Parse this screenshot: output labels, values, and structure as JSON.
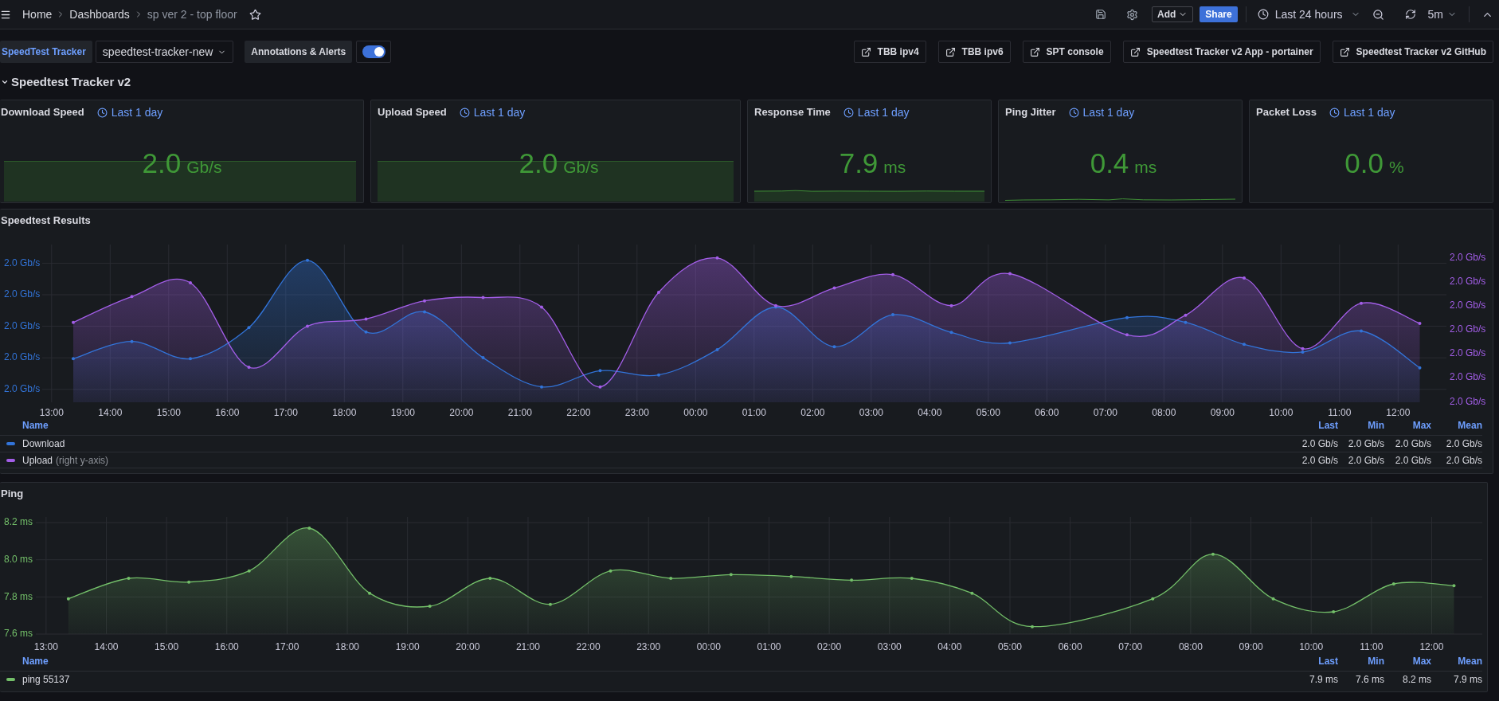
{
  "top_bar": {
    "breadcrumbs": [
      {
        "label": "Home",
        "current": false
      },
      {
        "label": "Dashboards",
        "current": false
      },
      {
        "label": "sp ver 2 - top floor",
        "current": true
      }
    ],
    "add_button": "Add",
    "share_button": "Share",
    "time_range": "Last 24 hours",
    "refresh_interval": "5m"
  },
  "variables": [
    {
      "label": "SpeedTest Tracker",
      "value": "speedtest-tracker-new"
    }
  ],
  "annotations_toggle": {
    "label": "Annotations & Alerts",
    "on": true
  },
  "links": [
    "TBB ipv4",
    "TBB ipv6",
    "SPT console",
    "Speedtest Tracker v2 App - portainer",
    "Speedtest Tracker v2 GitHub"
  ],
  "row": {
    "title": "Speedtest Tracker v2",
    "expanded": true
  },
  "stat_panels": [
    {
      "kind": "block",
      "title": "Download Speed",
      "time_range": "Last 1 day",
      "value": "2.0",
      "unit": "Gb/s"
    },
    {
      "kind": "block",
      "title": "Upload Speed",
      "time_range": "Last 1 day",
      "value": "2.0",
      "unit": "Gb/s"
    },
    {
      "kind": "band",
      "title": "Response Time",
      "time_range": "Last 1 day",
      "value": "7.9",
      "unit": "ms"
    },
    {
      "kind": "line",
      "title": "Ping Jitter",
      "time_range": "Last 1 day",
      "value": "0.4",
      "unit": "ms"
    },
    {
      "kind": "plain",
      "title": "Packet Loss",
      "time_range": "Last 1 day",
      "value": "0.0",
      "unit": "%"
    }
  ],
  "speedtest_results": {
    "title": "Speedtest Results",
    "y_axis_left": [
      "2.0 Gb/s",
      "2.0 Gb/s",
      "2.0 Gb/s",
      "2.0 Gb/s",
      "2.0 Gb/s"
    ],
    "y_axis_right": [
      "2.0 Gb/s",
      "2.0 Gb/s",
      "2.0 Gb/s",
      "2.0 Gb/s",
      "2.0 Gb/s",
      "2.0 Gb/s",
      "2.0 Gb/s"
    ],
    "x_axis": [
      "13:00",
      "14:00",
      "15:00",
      "16:00",
      "17:00",
      "18:00",
      "19:00",
      "20:00",
      "21:00",
      "22:00",
      "23:00",
      "00:00",
      "01:00",
      "02:00",
      "03:00",
      "04:00",
      "05:00",
      "06:00",
      "07:00",
      "08:00",
      "09:00",
      "10:00",
      "11:00",
      "12:00"
    ],
    "legend_columns": [
      "Name",
      "Last",
      "Min",
      "Max",
      "Mean"
    ],
    "series": [
      {
        "name": "Download",
        "color": "#3274d9",
        "stats": [
          "2.0 Gb/s",
          "2.0 Gb/s",
          "2.0 Gb/s",
          "2.0 Gb/s"
        ]
      },
      {
        "name": "Upload",
        "note": "(right y-axis)",
        "color": "#a35ee8",
        "stats": [
          "2.0 Gb/s",
          "2.0 Gb/s",
          "2.0 Gb/s",
          "2.0 Gb/s"
        ]
      }
    ]
  },
  "ping": {
    "title": "Ping",
    "chart_data": {
      "type": "area",
      "grid": true,
      "categories": [
        "13:00",
        "14:00",
        "15:00",
        "16:00",
        "17:00",
        "18:00",
        "19:00",
        "20:00",
        "21:00",
        "22:00",
        "23:00",
        "00:00",
        "01:00",
        "02:00",
        "03:00",
        "04:00",
        "05:00",
        "06:00",
        "07:00",
        "08:00",
        "09:00",
        "10:00",
        "11:00",
        "12:00"
      ],
      "series": [
        {
          "name": "ping 55137",
          "color": "#73bf69",
          "values": [
            7.79,
            7.9,
            7.88,
            7.94,
            8.17,
            7.82,
            7.75,
            7.9,
            7.76,
            7.94,
            7.9,
            7.92,
            7.91,
            7.89,
            7.9,
            7.82,
            7.64,
            null,
            7.79,
            8.03,
            7.79,
            7.72,
            7.87,
            7.86
          ]
        }
      ],
      "ylim": [
        7.6,
        8.23
      ],
      "yticks": [
        {
          "value": 7.6,
          "label": "7.6 ms"
        },
        {
          "value": 7.8,
          "label": "7.8 ms"
        },
        {
          "value": 8,
          "label": "8.0 ms"
        },
        {
          "value": 8.2,
          "label": "8.2 ms"
        }
      ]
    },
    "legend_columns": [
      "Name",
      "Last",
      "Min",
      "Max",
      "Mean"
    ],
    "legend_stats": [
      [
        "7.9 ms",
        "7.6 ms",
        "8.2 ms",
        "7.9 ms"
      ]
    ]
  }
}
